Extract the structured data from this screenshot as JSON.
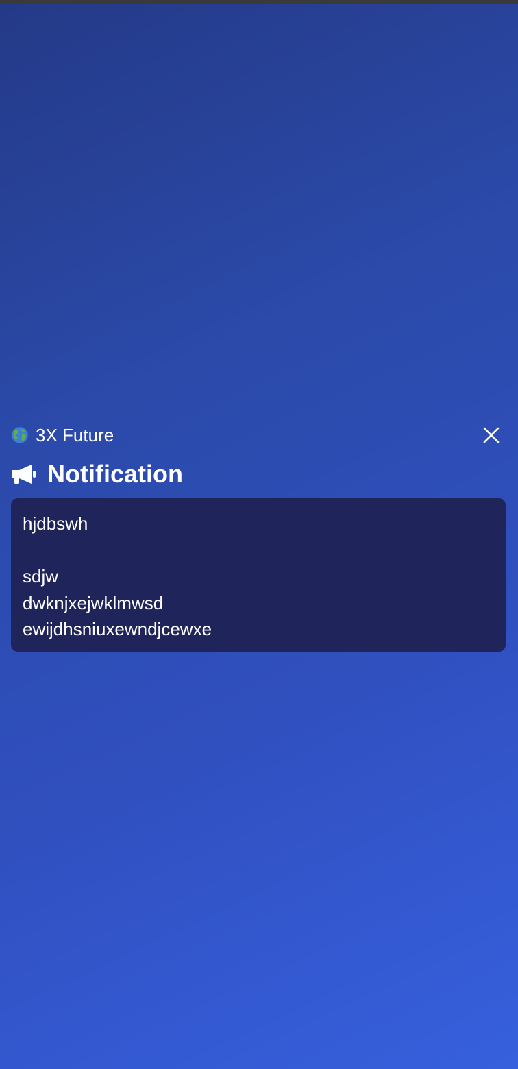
{
  "app": {
    "name": "3X Future",
    "icon": "globe-icon"
  },
  "header": {
    "close_icon": "close-icon"
  },
  "notification": {
    "title": "Notification",
    "icon": "megaphone-icon",
    "message_lines": [
      "hjdbswh",
      "",
      "sdjw",
      "dwknjxejwklmwsd",
      "ewijdhsniuxewndjcewxe"
    ]
  },
  "colors": {
    "background_start": "#243a87",
    "background_end": "#3760de",
    "message_box": "#1f255a",
    "text": "#ffffff"
  }
}
